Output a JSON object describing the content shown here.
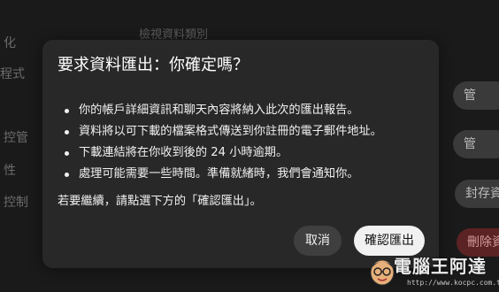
{
  "background": {
    "top_link": "檢視資料類別",
    "left_fragments": [
      "化",
      "程式",
      "控管",
      "性",
      "控制"
    ],
    "right_fragments": [
      "管",
      "管",
      "封存資料",
      "刪除資料"
    ]
  },
  "dialog": {
    "title": "要求資料匯出：你確定嗎？",
    "bullets": [
      "你的帳戶詳細資訊和聊天內容將納入此次的匯出報告。",
      "資料將以可下載的檔案格式傳送到你註冊的電子郵件地址。",
      "下載連結將在你收到後的 24 小時逾期。",
      "處理可能需要一些時間。準備就緒時，我們會通知你。"
    ],
    "footer": "若要繼續，請點選下方的「確認匯出」。",
    "cancel_label": "取消",
    "confirm_label": "確認匯出"
  },
  "watermark": {
    "title": "電腦王阿達",
    "url": "http://www.kocpc.com.tw"
  },
  "colors": {
    "dialog_bg": "#282828",
    "confirm_bg": "#f1f1f1",
    "cancel_bg": "#3f3f3f",
    "text": "#f1f1f1"
  }
}
